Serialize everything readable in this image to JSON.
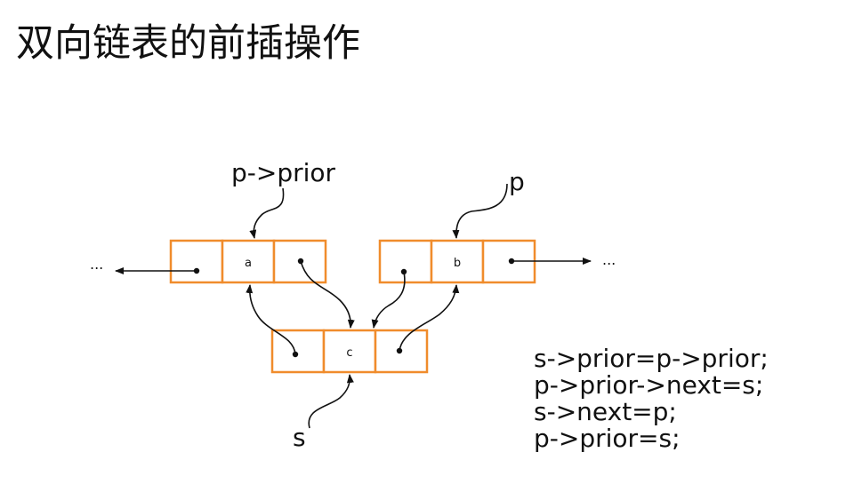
{
  "title": "双向链表的前插操作",
  "colors": {
    "node_border": "#f08c2c",
    "ink": "#111111",
    "background": "#ffffff"
  },
  "nodes": {
    "a": {
      "value": "a"
    },
    "b": {
      "value": "b"
    },
    "c": {
      "value": "c"
    }
  },
  "labels": {
    "p_prior": "p->prior",
    "p": "p",
    "s": "s",
    "ellipsis_left": "...",
    "ellipsis_right": "..."
  },
  "code_lines": [
    "s->prior=p->prior;",
    "p->prior->next=s;",
    "s->next=p;",
    "p->prior=s;"
  ]
}
